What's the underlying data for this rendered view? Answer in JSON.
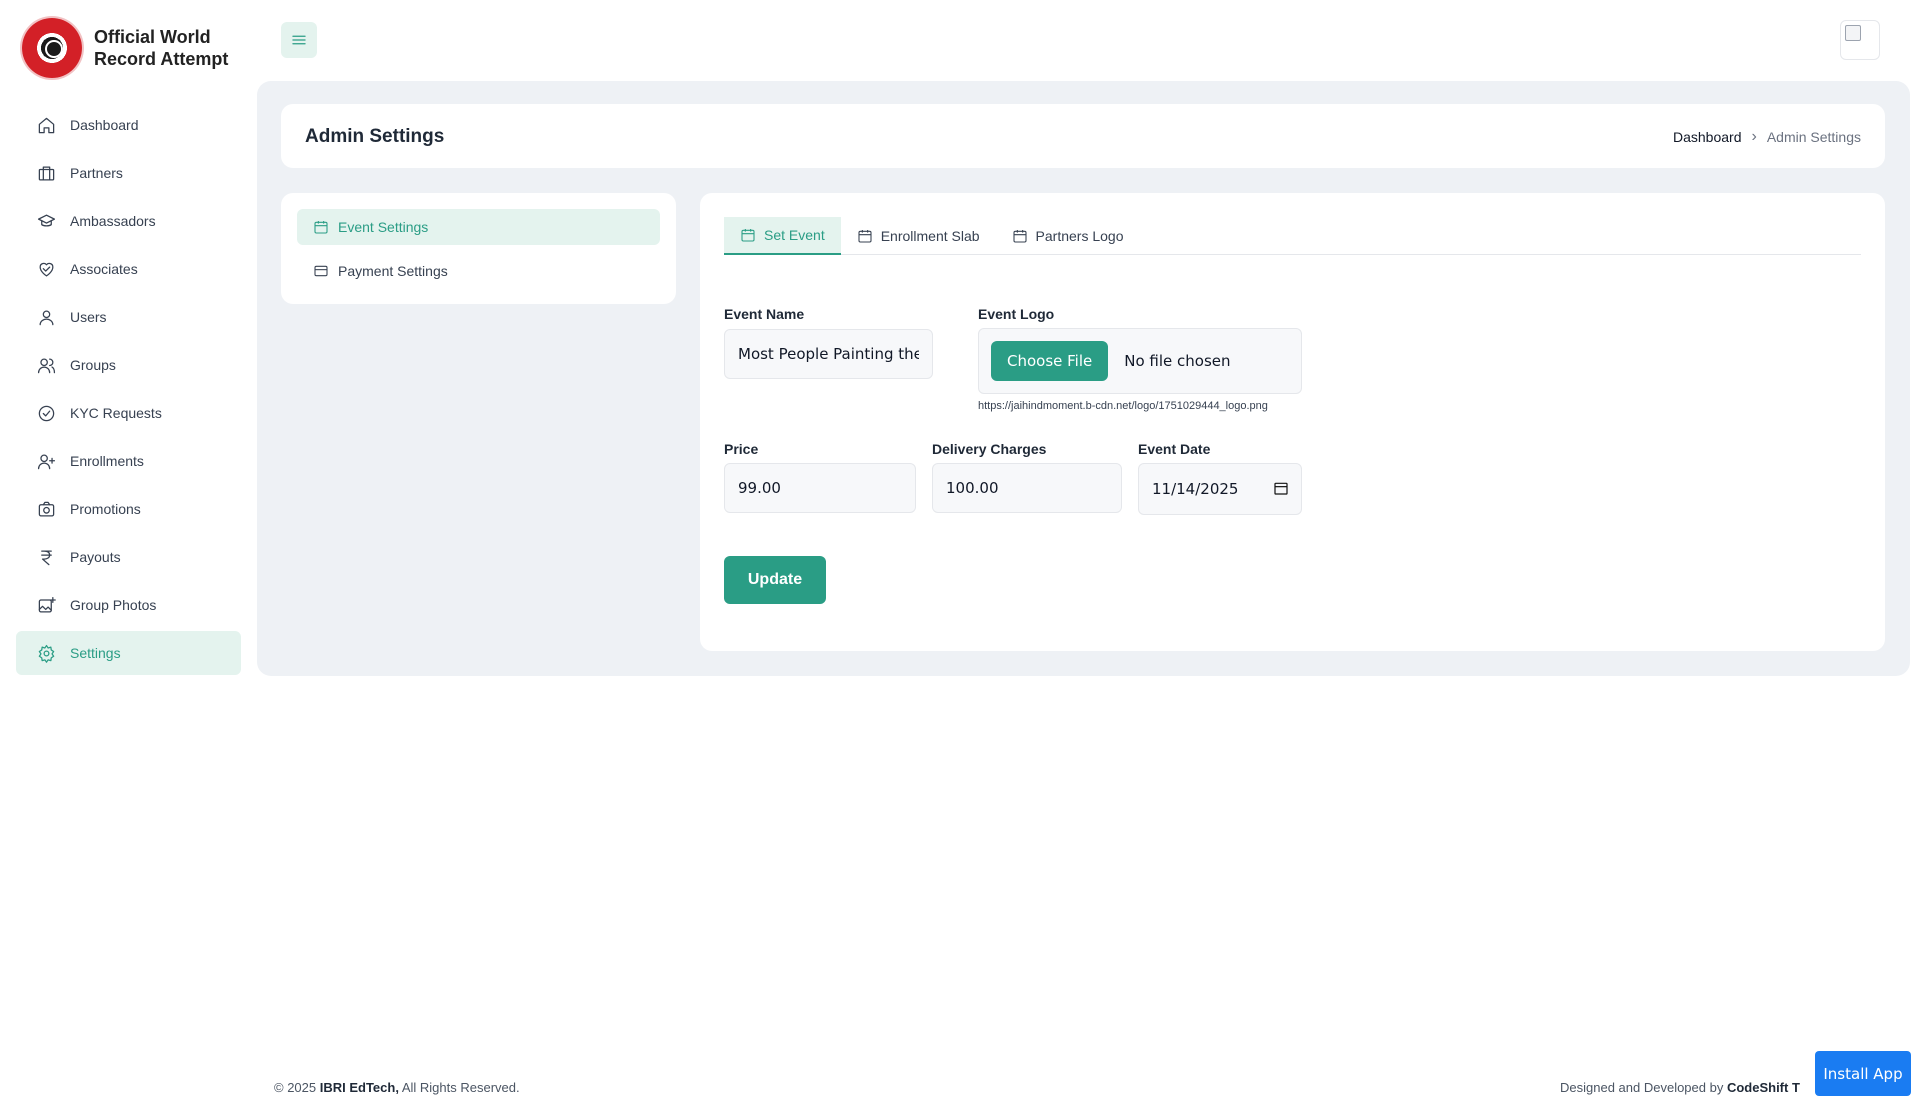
{
  "brand": {
    "line1": "Official World",
    "line2": "Record Attempt"
  },
  "sidebar": {
    "items": [
      {
        "label": "Dashboard",
        "icon": "home-icon"
      },
      {
        "label": "Partners",
        "icon": "briefcase-icon"
      },
      {
        "label": "Ambassadors",
        "icon": "graduation-cap-icon"
      },
      {
        "label": "Associates",
        "icon": "heart-handshake-icon"
      },
      {
        "label": "Users",
        "icon": "user-icon"
      },
      {
        "label": "Groups",
        "icon": "users-icon"
      },
      {
        "label": "KYC Requests",
        "icon": "check-circle-icon"
      },
      {
        "label": "Enrollments",
        "icon": "user-plus-icon"
      },
      {
        "label": "Promotions",
        "icon": "camera-icon"
      },
      {
        "label": "Payouts",
        "icon": "rupee-icon"
      },
      {
        "label": "Group Photos",
        "icon": "image-plus-icon"
      },
      {
        "label": "Settings",
        "icon": "gear-icon",
        "active": true
      }
    ]
  },
  "page": {
    "title": "Admin Settings",
    "breadcrumb": {
      "home": "Dashboard",
      "current": "Admin Settings"
    }
  },
  "settings_menu": {
    "items": [
      {
        "label": "Event Settings",
        "icon": "calendar-icon",
        "active": true
      },
      {
        "label": "Payment Settings",
        "icon": "credit-card-icon"
      }
    ]
  },
  "tabs": [
    {
      "label": "Set Event",
      "icon": "calendar-icon",
      "active": true
    },
    {
      "label": "Enrollment Slab",
      "icon": "calendar-icon"
    },
    {
      "label": "Partners Logo",
      "icon": "calendar-icon"
    }
  ],
  "form": {
    "event_name_label": "Event Name",
    "event_name_value": "Most People Painting the",
    "event_logo_label": "Event Logo",
    "choose_file_label": "Choose File",
    "file_status": "No file chosen",
    "logo_url": "https://jaihindmoment.b-cdn.net/logo/1751029444_logo.png",
    "price_label": "Price",
    "price_value": "99.00",
    "delivery_label": "Delivery Charges",
    "delivery_value": "100.00",
    "date_label": "Event Date",
    "date_value": "11/14/2025",
    "update_label": "Update"
  },
  "footer": {
    "copyright_prefix": "© 2025 ",
    "company": "IBRI EdTech,",
    "rights": " All Rights Reserved.",
    "designed_prefix": "Designed and Developed by ",
    "designer": "CodeShift T"
  },
  "install_app_label": "Install App",
  "colors": {
    "accent": "#2a9d85",
    "accent_light": "#e4f3ee",
    "install_blue": "#1a7cf2"
  }
}
